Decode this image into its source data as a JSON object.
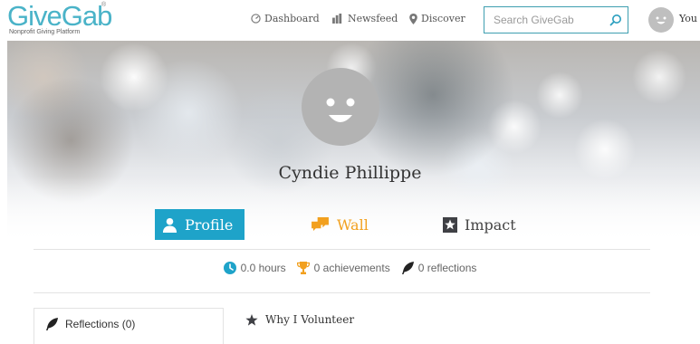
{
  "brand": {
    "name": "GiveGab",
    "tagline": "Nonprofit Giving Platform",
    "registered_mark": "®",
    "color": "#4ab3c8"
  },
  "nav": {
    "items": [
      {
        "label": "Dashboard",
        "icon": "dashboard-icon"
      },
      {
        "label": "Newsfeed",
        "icon": "newsfeed-icon"
      },
      {
        "label": "Discover",
        "icon": "location-pin-icon"
      }
    ],
    "search_placeholder": "Search GiveGab",
    "user_label": "You"
  },
  "profile": {
    "name": "Cyndie Phillippe",
    "avatar": "default-smiley-avatar"
  },
  "tabs": [
    {
      "label": "Profile",
      "icon": "person-icon",
      "active": true,
      "color": "#1ea3c9"
    },
    {
      "label": "Wall",
      "icon": "speech-bubbles-icon",
      "active": false,
      "color": "#f2a01e"
    },
    {
      "label": "Impact",
      "icon": "star-badge-icon",
      "active": false,
      "color": "#444444"
    }
  ],
  "stats": {
    "hours": "0.0 hours",
    "achievements": "0 achievements",
    "reflections": "0 reflections"
  },
  "sidebar": {
    "reflections_label": "Reflections (0)"
  },
  "sections": {
    "why_volunteer": "Why I Volunteer"
  }
}
